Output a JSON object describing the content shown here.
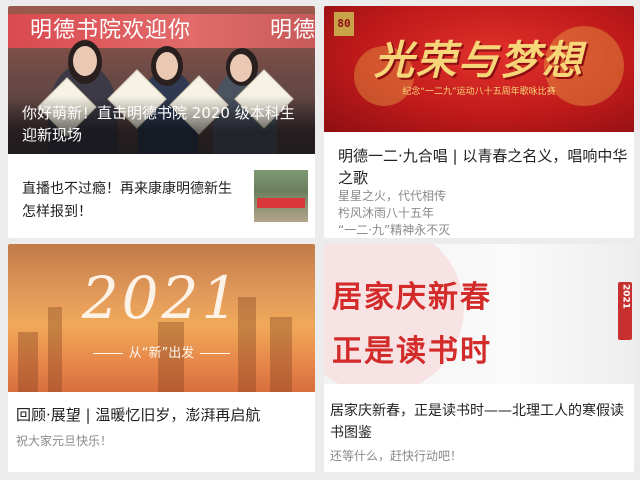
{
  "cards": [
    {
      "banner_left": "明德书院欢迎你",
      "banner_right": "明德",
      "sign_text": "",
      "overlay_title": "你好萌新！直击明德书院 2020 级本科生迎新现场",
      "subtitle": "直播也不过瘾！再来康康明德新生怎样报到！"
    },
    {
      "poster_logo": "80",
      "poster_title": "光荣与梦想",
      "poster_subtitle": "纪念“一二九”运动八十五周年歌咏比赛",
      "title": "明德一二·九合唱 | 以青春之名义，唱响中华之歌",
      "lines": [
        "星星之火，代代相传",
        "枍风沐雨八十五年",
        "“一二·九”精神永不灭"
      ]
    },
    {
      "year": "2021",
      "slogan": "从“新”出发",
      "title": "回顾·展望 | 温暖忆旧岁，澎湃再启航",
      "subtitle": "祝大家元旦快乐！"
    },
    {
      "line1": "居家庆新春",
      "line2": "正是读书时",
      "tag": "2021",
      "title": "居家庆新春，正是读书时——北理工人的寒假读书图鉴",
      "subtitle": "还等什么，赶快行动吧！"
    }
  ]
}
